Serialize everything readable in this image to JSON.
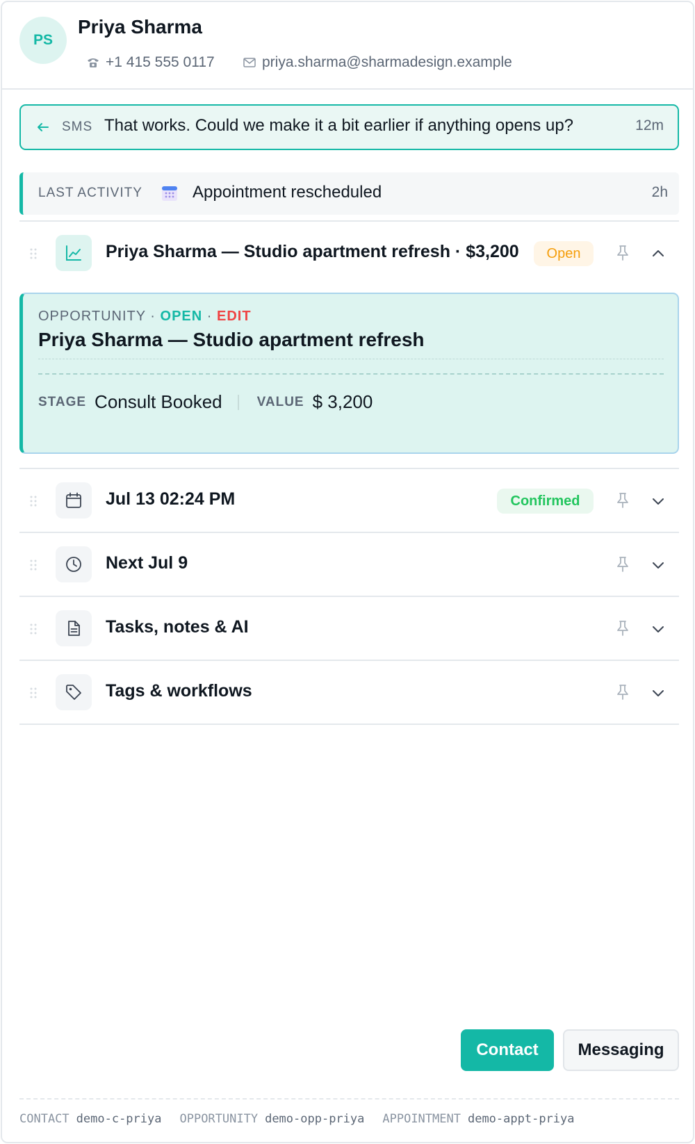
{
  "contact": {
    "initials": "PS",
    "name": "Priya Sharma",
    "phone": "+1 415 555 0117",
    "email": "priya.sharma@sharmadesign.example"
  },
  "sms": {
    "label": "SMS",
    "text": "That works. Could we make it a bit earlier if anything opens up?",
    "time": "12m"
  },
  "last_activity": {
    "label": "LAST ACTIVITY",
    "text": "Appointment rescheduled",
    "time": "2h",
    "icon": "calendar-icon"
  },
  "rows": {
    "opportunity": {
      "title": "Priya Sharma — Studio apartment refresh · $3,200",
      "badge": "Open",
      "icon": "chart-icon"
    },
    "appointment": {
      "title": "Jul 13 02:24 PM",
      "badge": "Confirmed",
      "icon": "calendar-icon"
    },
    "next": {
      "title": "Next Jul 9",
      "icon": "clock-icon"
    },
    "tasks": {
      "title": "Tasks, notes & AI",
      "icon": "document-icon"
    },
    "tags": {
      "title": "Tags & workflows",
      "icon": "tag-icon"
    }
  },
  "opportunity_card": {
    "crumb_type": "OPPORTUNITY",
    "crumb_sep": "·",
    "crumb_status": "OPEN",
    "crumb_edit": "EDIT",
    "title": "Priya Sharma — Studio apartment refresh",
    "stage_label": "STAGE",
    "stage_value": "Consult Booked",
    "value_label": "VALUE",
    "value_value": "$ 3,200"
  },
  "buttons": {
    "contact": "Contact",
    "messaging": "Messaging"
  },
  "footer": {
    "contact_key": "CONTACT",
    "contact_id": "demo-c-priya",
    "opportunity_key": "OPPORTUNITY",
    "opportunity_id": "demo-opp-priya",
    "appointment_key": "APPOINTMENT",
    "appointment_id": "demo-appt-priya"
  },
  "colors": {
    "accent": "#14b8a6",
    "open": "#f59e0b",
    "confirmed": "#22c55e",
    "edit": "#ef4444"
  }
}
